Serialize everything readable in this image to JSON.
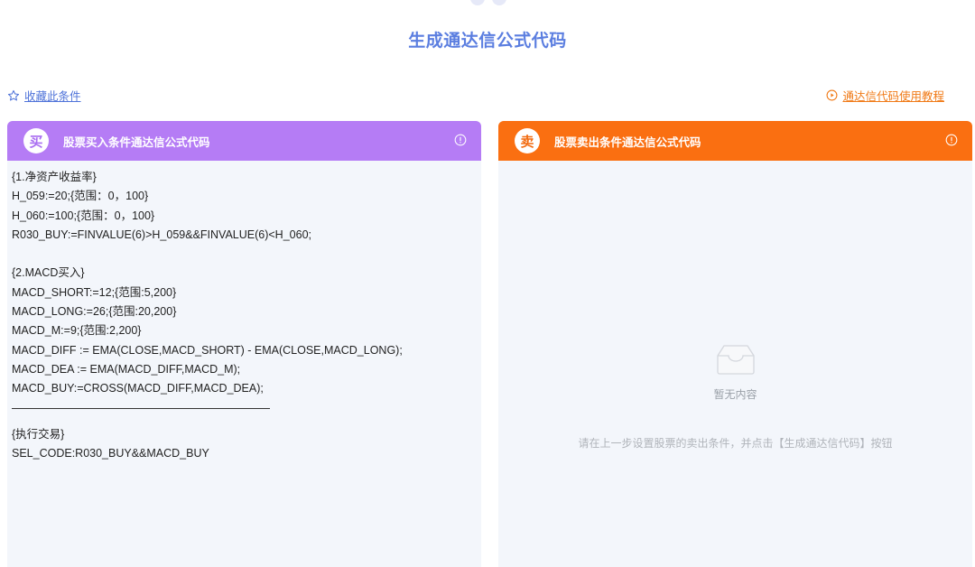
{
  "page": {
    "title": "生成通达信公式代码"
  },
  "links": {
    "favorite": "收藏此条件",
    "tutorial": "通达信代码使用教程"
  },
  "buy_panel": {
    "badge": "买",
    "title": "股票买入条件通达信公式代码",
    "code_block_1": [
      "{1.净资产收益率}",
      "H_059:=20;{范围：0，100}",
      "H_060:=100;{范围：0，100}",
      "R030_BUY:=FINVALUE(6)>H_059&&FINVALUE(6)<H_060;",
      "",
      "{2.MACD买入}",
      "MACD_SHORT:=12;{范围:5,200}",
      "MACD_LONG:=26;{范围:20,200}",
      "MACD_M:=9;{范围:2,200}",
      "MACD_DIFF := EMA(CLOSE,MACD_SHORT) - EMA(CLOSE,MACD_LONG);",
      "MACD_DEA := EMA(MACD_DIFF,MACD_M);",
      "MACD_BUY:=CROSS(MACD_DIFF,MACD_DEA);"
    ],
    "code_block_2": [
      "{执行交易}",
      "SEL_CODE:R030_BUY&&MACD_BUY"
    ]
  },
  "sell_panel": {
    "badge": "卖",
    "title": "股票卖出条件通达信公式代码",
    "empty_text": "暂无内容",
    "empty_hint": "请在上一步设置股票的卖出条件，并点击【生成通达信代码】按钮"
  },
  "colors": {
    "title_blue": "#5b7ee0",
    "buy_purple": "#b57cf5",
    "sell_orange": "#fa6f11",
    "panel_bg": "#f3f6fb"
  },
  "icons": {
    "favorite": "star-outline-icon",
    "tutorial": "play-circle-icon",
    "info": "info-circle-icon",
    "empty": "empty-inbox-icon"
  }
}
